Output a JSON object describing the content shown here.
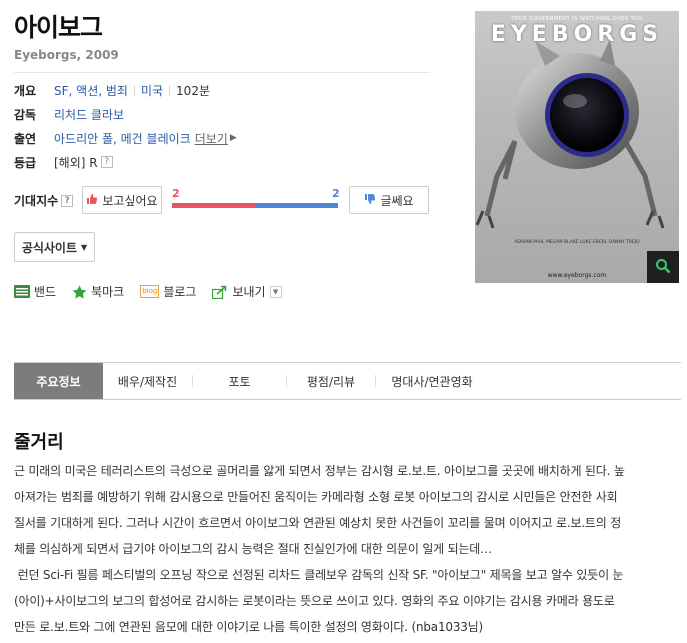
{
  "movie": {
    "title": "아이보그",
    "subtitle": "Eyeborgs, 2009"
  },
  "info": {
    "overview": {
      "label": "개요",
      "genre": "SF, 액션, 범죄",
      "country": "미국",
      "runtime": "102분"
    },
    "director": {
      "label": "감독",
      "name": "리처드 클라보"
    },
    "cast": {
      "label": "출연",
      "names": "아드리안 폴, 메건 블레이크",
      "more": "더보기"
    },
    "rating": {
      "label": "등급",
      "value": "[해외] R"
    }
  },
  "expectation": {
    "label": "기대지수",
    "like_label": "보고싶어요",
    "like_count": "2",
    "dislike_label": "글쎄요",
    "dislike_count": "2",
    "like_share": 0.5,
    "colors": {
      "like": "#e8555f",
      "dislike": "#4f86d6"
    }
  },
  "official_site": "공식사이트",
  "share": {
    "band": "밴드",
    "bookmark": "북마크",
    "blog": "블로그",
    "blog_badge": "blog",
    "send": "보내기"
  },
  "poster": {
    "tagline": "YOUR GOVERNMENT IS WATCHING OVER YOU",
    "logo": "EYEBORGS"
  },
  "tabs": [
    {
      "label": "주요정보",
      "active": true
    },
    {
      "label": "배우/제작진",
      "active": false
    },
    {
      "label": "포토",
      "active": false
    },
    {
      "label": "평점/리뷰",
      "active": false
    },
    {
      "label": "명대사/연관영화",
      "active": false
    }
  ],
  "synopsis": {
    "title": "줄거리",
    "lines": [
      "근 미래의 미국은 테러리스트의 극성으로 골머리를 앓게 되면서 정부는 감시형 로.보.트. 아이보그를 곳곳에 배치하게 된다. 높",
      "아져가는 범죄를 예방하기 위해 감시용으로 만들어진 움직이는 카메라형 소형 로봇 아이보그의 감시로 시민들은 안전한 사회",
      "질서를 기대하게 된다. 그러나 시간이 흐르면서 아이보그와 연관된 예상치 못한 사건들이 꼬리를 물며 이어지고 로.보.트의 정",
      "체를 의심하게 되면서 급기야 아이보그의 감시 능력은 절대 진실인가에 대한 의문이 일게 되는데…",
      " 런던 Sci-Fi 필름 페스티벌의 오프닝 작으로 선정된 리차드 클레보우 감독의 신작 SF. \"아이보그\" 제목을 보고 알수 있듯이 눈",
      "(아이)+사이보그의 보그의 합성어로 감시하는 로봇이라는 뜻으로 쓰이고 있다. 영화의 주요 이야기는 감시용 카메라 용도로",
      "만든 로.보.트와 그에 연관된 음모에 대한 이야기로 나름 특이한 설정의 영화이다. (nba1033님)"
    ]
  }
}
